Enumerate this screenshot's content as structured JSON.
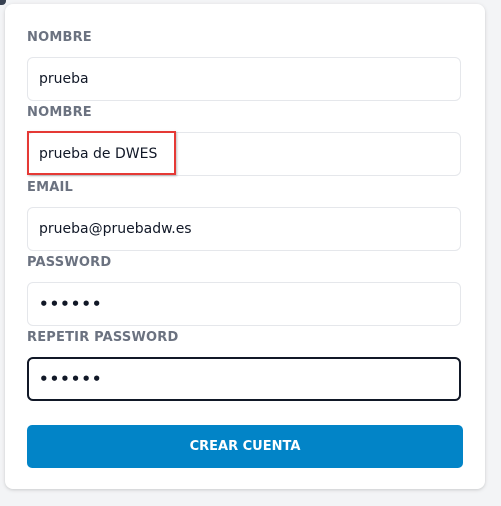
{
  "form": {
    "fields": [
      {
        "label": "NOMBRE",
        "value": "prueba"
      },
      {
        "label": "NOMBRE",
        "value": "prueba de DWES"
      },
      {
        "label": "EMAIL",
        "value": "prueba@pruebadw.es"
      },
      {
        "label": "PASSWORD",
        "value": "••••••"
      },
      {
        "label": "REPETIR PASSWORD",
        "value": "••••••"
      }
    ],
    "submit_label": "CREAR CUENTA"
  },
  "colors": {
    "accent": "#0284c7",
    "label": "#6b7280",
    "highlight": "#e53935"
  }
}
